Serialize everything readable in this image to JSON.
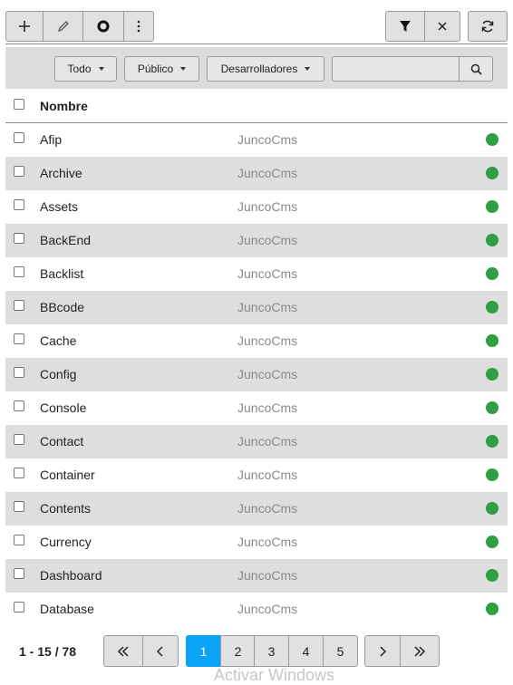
{
  "toolbar": {
    "add_icon": "plus-icon",
    "edit_icon": "pencil-icon",
    "status_icon": "circle-dot-icon",
    "more_icon": "vertical-dots-icon",
    "filter_icon": "funnel-icon",
    "clear_icon": "close-icon",
    "refresh_icon": "refresh-icon"
  },
  "filters": {
    "scope": "Todo",
    "visibility": "Público",
    "role": "Desarrolladores",
    "search_value": "",
    "search_icon": "search-icon"
  },
  "table": {
    "header": "Nombre",
    "rows": [
      {
        "name": "Afip",
        "vendor": "JuncoCms"
      },
      {
        "name": "Archive",
        "vendor": "JuncoCms"
      },
      {
        "name": "Assets",
        "vendor": "JuncoCms"
      },
      {
        "name": "BackEnd",
        "vendor": "JuncoCms"
      },
      {
        "name": "Backlist",
        "vendor": "JuncoCms"
      },
      {
        "name": "BBcode",
        "vendor": "JuncoCms"
      },
      {
        "name": "Cache",
        "vendor": "JuncoCms"
      },
      {
        "name": "Config",
        "vendor": "JuncoCms"
      },
      {
        "name": "Console",
        "vendor": "JuncoCms"
      },
      {
        "name": "Contact",
        "vendor": "JuncoCms"
      },
      {
        "name": "Container",
        "vendor": "JuncoCms"
      },
      {
        "name": "Contents",
        "vendor": "JuncoCms"
      },
      {
        "name": "Currency",
        "vendor": "JuncoCms"
      },
      {
        "name": "Dashboard",
        "vendor": "JuncoCms"
      },
      {
        "name": "Database",
        "vendor": "JuncoCms"
      }
    ],
    "status_color": "#2ea043"
  },
  "pagination": {
    "range": "1 - 15",
    "total": "78",
    "first_icon": "double-chevron-left-icon",
    "prev_icon": "chevron-left-icon",
    "pages": [
      "1",
      "2",
      "3",
      "4",
      "5"
    ],
    "current": "1",
    "next_icon": "chevron-right-icon",
    "last_icon": "double-chevron-right-icon",
    "active_color": "#0aa3f5"
  },
  "watermark": "Activar Windows"
}
